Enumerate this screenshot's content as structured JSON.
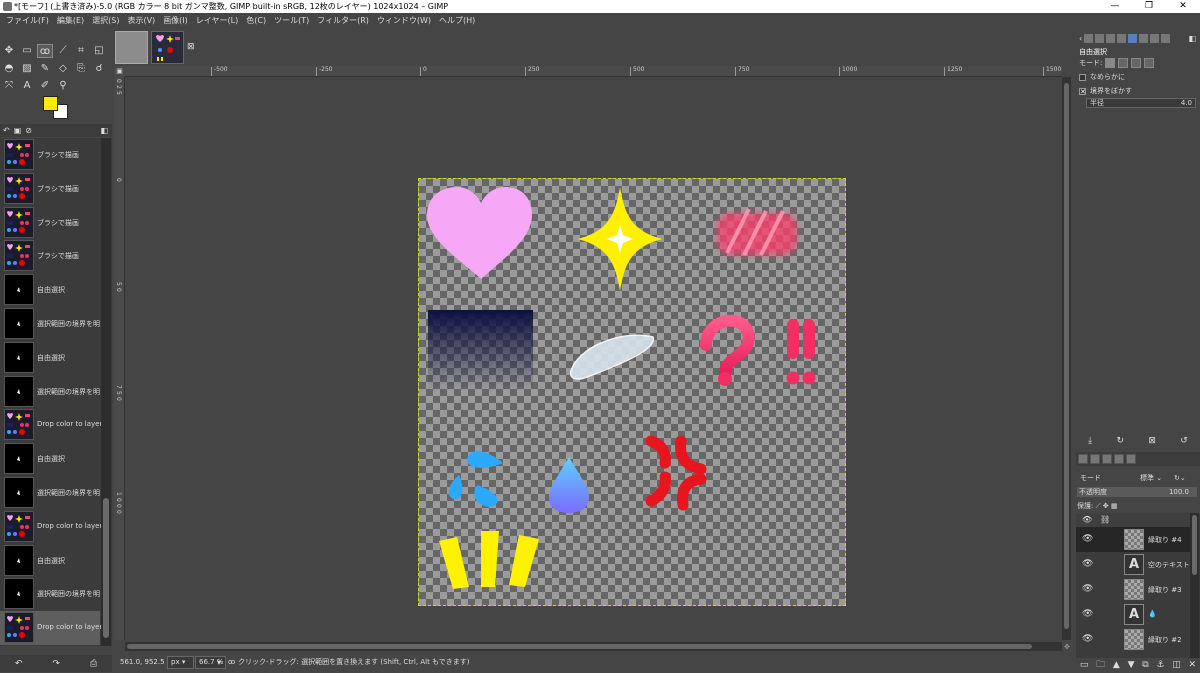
{
  "window": {
    "title": "*[モーフ] (上書き済み)-5.0 (RGB カラー 8 bit ガンマ整数, GIMP built-in sRGB, 12枚のレイヤー) 1024x1024 – GIMP",
    "minimize": "—",
    "maximize": "❐",
    "close": "✕"
  },
  "menu": [
    "ファイル(F)",
    "編集(E)",
    "選択(S)",
    "表示(V)",
    "画像(I)",
    "レイヤー(L)",
    "色(C)",
    "ツール(T)",
    "フィルター(R)",
    "ウィンドウ(W)",
    "ヘルプ(H)"
  ],
  "colors": {
    "foreground": "#ffea00",
    "background": "#ffffff"
  },
  "history": {
    "items": [
      {
        "label": "ブラシで描画",
        "thumb": "image"
      },
      {
        "label": "ブラシで描画",
        "thumb": "image"
      },
      {
        "label": "ブラシで描画",
        "thumb": "image"
      },
      {
        "label": "ブラシで描画",
        "thumb": "image"
      },
      {
        "label": "自由選択",
        "thumb": "black"
      },
      {
        "label": "選択範囲の境界を明",
        "thumb": "black"
      },
      {
        "label": "自由選択",
        "thumb": "black"
      },
      {
        "label": "選択範囲の境界を明",
        "thumb": "black"
      },
      {
        "label": "Drop color to layer",
        "thumb": "image"
      },
      {
        "label": "自由選択",
        "thumb": "black"
      },
      {
        "label": "選択範囲の境界を明",
        "thumb": "black"
      },
      {
        "label": "Drop color to layer",
        "thumb": "image"
      },
      {
        "label": "自由選択",
        "thumb": "black"
      },
      {
        "label": "選択範囲の境界を明",
        "thumb": "black"
      },
      {
        "label": "Drop color to layer",
        "thumb": "image",
        "active": true
      }
    ]
  },
  "ruler": {
    "h": [
      "-500",
      "-250",
      "0",
      "250",
      "500",
      "750",
      "1000",
      "1250",
      "1500"
    ],
    "v": [
      "0",
      "2",
      "5",
      "0",
      "5",
      "0",
      "7",
      "5",
      "0",
      "1",
      "0",
      "0",
      "0"
    ]
  },
  "status": {
    "coords": "561.0, 952.5",
    "unit": "px",
    "zoom": "66.7 %",
    "message": "クリック-ドラッグ: 選択範囲を置き換えます (Shift, Ctrl, Alt もできます)"
  },
  "tool_options": {
    "title": "自由選択",
    "mode_label": "モード:",
    "antialias": "なめらかに",
    "feather": "境界をぼかす",
    "radius_label": "半径",
    "radius_value": "4.0",
    "antialias_checked": false,
    "feather_checked": true
  },
  "layers": {
    "mode_label": "モード",
    "mode_value": "標準",
    "opacity_label": "不透明度",
    "opacity_value": "100.0",
    "lock_label": "保護:",
    "items": [
      {
        "name": "縁取り #4",
        "type": "image",
        "active": true
      },
      {
        "name": "空のテキスト",
        "type": "text"
      },
      {
        "name": "縁取り #3",
        "type": "image"
      },
      {
        "name": "💧",
        "type": "text"
      },
      {
        "name": "縁取り #2",
        "type": "image"
      }
    ]
  }
}
